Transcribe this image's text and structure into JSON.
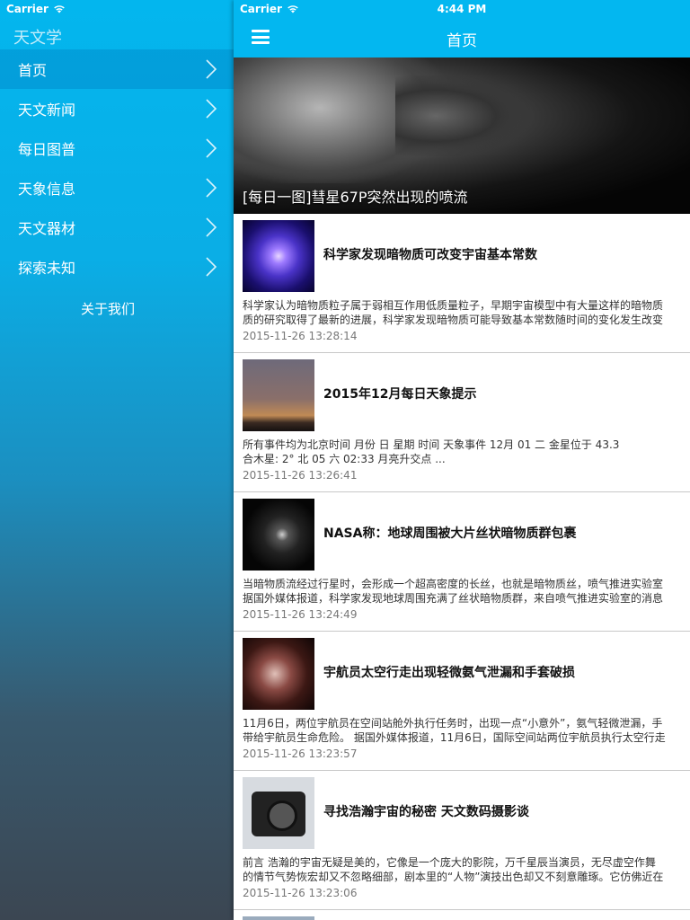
{
  "sidebar": {
    "status": {
      "carrier": "Carrier"
    },
    "app_title": "天文学",
    "menu": [
      {
        "label": "首页",
        "active": true
      },
      {
        "label": "天文新闻"
      },
      {
        "label": "每日图普"
      },
      {
        "label": "天象信息"
      },
      {
        "label": "天文器材"
      },
      {
        "label": "探索未知"
      }
    ],
    "about": "关于我们"
  },
  "main": {
    "status": {
      "carrier": "Carrier",
      "time": "4:44 PM"
    },
    "nav_title": "首页",
    "hero": {
      "caption": "[每日一图]彗星67P突然出现的喷流"
    },
    "articles": [
      {
        "title": "科学家发现暗物质可改变宇宙基本常数",
        "desc_line1": "科学家认为暗物质粒子属于弱相互作用低质量粒子，早期宇宙模型中有大量这样的暗物质",
        "desc_line2": "质的研究取得了最新的进展，科学家发现暗物质可能导致基本常数随时间的变化发生改变",
        "time": "2015-11-26 13:28:14"
      },
      {
        "title": "2015年12月每日天象提示",
        "desc_line1": "所有事件均为北京时间 月份 日     星期      时间        天象事件 12月 01 二 金星位于 43.3",
        "desc_line2": "合木星:   2° 北 05 六 02:33 月亮升交点 ...",
        "time": "2015-11-26 13:26:41"
      },
      {
        "title": "NASA称：地球周围被大片丝状暗物质群包裹",
        "desc_line1": "当暗物质流经过行星时，会形成一个超高密度的长丝，也就是暗物质丝，喷气推进实验室",
        "desc_line2": "据国外媒体报道，科学家发现地球周围充满了丝状暗物质群，来自喷气推进实验室的消息",
        "time": "2015-11-26 13:24:49"
      },
      {
        "title": "宇航员太空行走出现轻微氨气泄漏和手套破损",
        "desc_line1": "11月6日，两位宇航员在空间站舱外执行任务时，出现一点“小意外”，氨气轻微泄漏，手",
        "desc_line2": "带给宇航员生命危险。 据国外媒体报道，11月6日，国际空间站两位宇航员执行太空行走",
        "time": "2015-11-26 13:23:57"
      },
      {
        "title": "寻找浩瀚宇宙的秘密 天文数码摄影谈",
        "desc_line1": "前言 浩瀚的宇宙无疑是美的，它像是一个庞大的影院，万千星辰当演员，无尽虚空作舞",
        "desc_line2": "的情节气势恢宏却又不忽略细部，剧本里的“人物”演技出色却又不刻意雕琢。它仿佛近在",
        "time": "2015-11-26 13:23:06"
      }
    ]
  }
}
